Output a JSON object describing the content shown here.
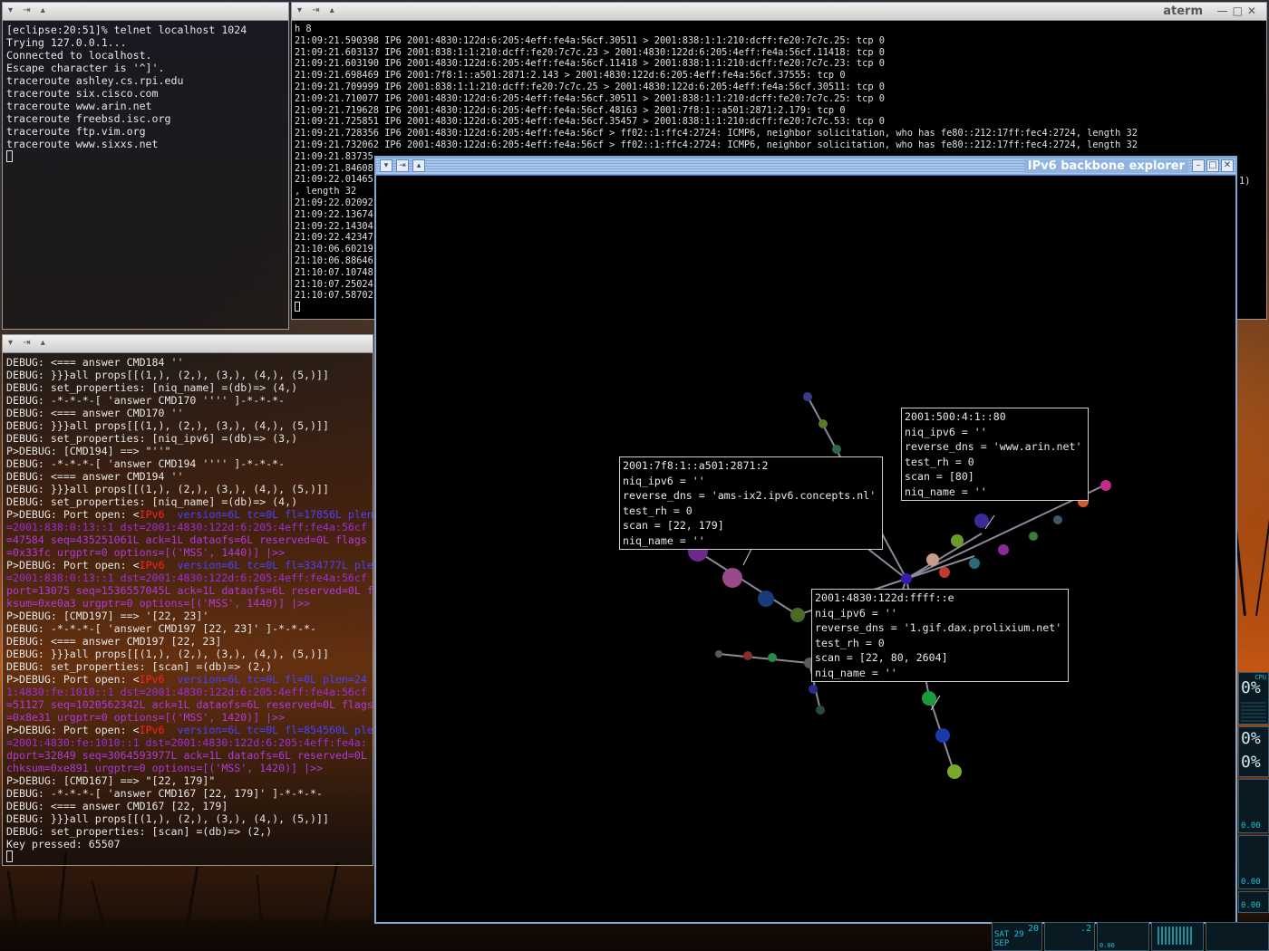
{
  "telnet_window": {
    "lines": [
      "[eclipse:20:51]% telnet localhost 1024",
      "Trying 127.0.0.1...",
      "Connected to localhost.",
      "Escape character is '^]'.",
      "traceroute ashley.cs.rpi.edu",
      "traceroute six.cisco.com",
      "traceroute www.arin.net",
      "traceroute freebsd.isc.org",
      "traceroute ftp.vim.org",
      "traceroute www.sixxs.net"
    ]
  },
  "aterm_window": {
    "title": "aterm",
    "lines": [
      "h 8",
      "21:09:21.590398 IP6 2001:4830:122d:6:205:4eff:fe4a:56cf.30511 > 2001:838:1:1:210:dcff:fe20:7c7c.25: tcp 0",
      "21:09:21.603137 IP6 2001:838:1:1:210:dcff:fe20:7c7c.23 > 2001:4830:122d:6:205:4eff:fe4a:56cf.11418: tcp 0",
      "21:09:21.603190 IP6 2001:4830:122d:6:205:4eff:fe4a:56cf.11418 > 2001:838:1:1:210:dcff:fe20:7c7c.23: tcp 0",
      "21:09:21.698469 IP6 2001:7f8:1::a501:2871:2.143 > 2001:4830:122d:6:205:4eff:fe4a:56cf.37555: tcp 0",
      "21:09:21.709999 IP6 2001:838:1:1:210:dcff:fe20:7c7c.25 > 2001:4830:122d:6:205:4eff:fe4a:56cf.30511: tcp 0",
      "21:09:21.710077 IP6 2001:4830:122d:6:205:4eff:fe4a:56cf.30511 > 2001:838:1:1:210:dcff:fe20:7c7c.25: tcp 0",
      "21:09:21.719628 IP6 2001:4830:122d:6:205:4eff:fe4a:56cf.48163 > 2001:7f8:1::a501:2871:2.179: tcp 0",
      "21:09:21.725851 IP6 2001:4830:122d:6:205:4eff:fe4a:56cf.35457 > 2001:838:1:1:210:dcff:fe20:7c7c.53: tcp 0",
      "21:09:21.728356 IP6 2001:4830:122d:6:205:4eff:fe4a:56cf > ff02::1:ffc4:2724: ICMP6, neighbor solicitation, who has fe80::212:17ff:fec4:2724, length 32",
      "21:09:21.732062 IP6 2001:4830:122d:6:205:4eff:fe4a:56cf > ff02::1:ffc4:2724: ICMP6, neighbor solicitation, who has fe80::212:17ff:fec4:2724, length 32",
      "21:09:21.83735",
      "21:09:21.84608",
      "21:09:22.01465",
      ", length 32",
      "21:09:22.02092",
      "21:09:22.13674",
      "21:09:22.14304",
      "21:09:22.42347",
      "21:10:06.60219",
      "21:10:06.88646",
      "21:10:07.10748",
      "21:10:07.25024",
      "21:10:07.58702"
    ],
    "overflow_text": "1)"
  },
  "debug_window": {
    "lines": [
      [
        {
          "t": "DEBUG: <=== answer CMD184 ''"
        }
      ],
      [
        {
          "t": "DEBUG: }}}all props[[(1,), (2,), (3,), (4,), (5,)]]"
        }
      ],
      [
        {
          "t": "DEBUG: set_properties: [niq_name] =(db)=> (4,)"
        }
      ],
      [
        {
          "t": "DEBUG: -*-*-*-[ 'answer CMD170 '''' ]-*-*-*-"
        }
      ],
      [
        {
          "t": "DEBUG: <=== answer CMD170 ''"
        }
      ],
      [
        {
          "t": "DEBUG: }}}all props[[(1,), (2,), (3,), (4,), (5,)]]"
        }
      ],
      [
        {
          "t": "DEBUG: set_properties: [niq_ipv6] =(db)=> (3,)"
        }
      ],
      [
        {
          "t": "P>DEBUG: [CMD194] ==> \"''\""
        }
      ],
      [
        {
          "t": "DEBUG: -*-*-*-[ 'answer CMD194 '''' ]-*-*-*-"
        }
      ],
      [
        {
          "t": "DEBUG: <=== answer CMD194 ''"
        }
      ],
      [
        {
          "t": "DEBUG: }}}all props[[(1,), (2,), (3,), (4,), (5,)]]"
        }
      ],
      [
        {
          "t": "DEBUG: set_properties: [niq_name] =(db)=> (4,)"
        }
      ],
      [
        {
          "t": "P>DEBUG: Port open: <"
        },
        {
          "t": "IPv6",
          "c": "c-red"
        },
        {
          "t": "  version=6L tc=0L fl=17856L plen",
          "c": "c-blue"
        }
      ],
      [
        {
          "t": "=2001:838:0:13::1 dst=2001:4830:122d:6:205:4eff:fe4a:56cf",
          "c": "c-purple"
        }
      ],
      [
        {
          "t": "=47584 seq=435251061L ack=1L dataofs=6L reserved=0L flags",
          "c": "c-violet"
        }
      ],
      [
        {
          "t": "=0x33fc urgptr=0 options=[('MSS', 1440)] |>>",
          "c": "c-violet"
        }
      ],
      [
        {
          "t": "P>DEBUG: Port open: <"
        },
        {
          "t": "IPv6",
          "c": "c-red"
        },
        {
          "t": "  version=6L tc=0L fl=334777L ple",
          "c": "c-blue"
        }
      ],
      [
        {
          "t": "=2001:838:0:13::1 dst=2001:4830:122d:6:205:4eff:fe4a:56cf",
          "c": "c-purple"
        }
      ],
      [
        {
          "t": "port=13075 seq=1536557045L ack=1L dataofs=6L reserved=0L f",
          "c": "c-violet"
        }
      ],
      [
        {
          "t": "ksum=0xe0a3 urgptr=0 options=[('MSS', 1440)] |>>",
          "c": "c-violet"
        }
      ],
      [
        {
          "t": "P>DEBUG: [CMD197] ==> '[22, 23]'"
        }
      ],
      [
        {
          "t": "DEBUG: -*-*-*-[ 'answer CMD197 [22, 23]' ]-*-*-*-"
        }
      ],
      [
        {
          "t": "DEBUG: <=== answer CMD197 [22, 23]"
        }
      ],
      [
        {
          "t": "DEBUG: }}}all props[[(1,), (2,), (3,), (4,), (5,)]]"
        }
      ],
      [
        {
          "t": "DEBUG: set_properties: [scan] =(db)=> (2,)"
        }
      ],
      [
        {
          "t": "P>DEBUG: Port open: <"
        },
        {
          "t": "IPv6",
          "c": "c-red"
        },
        {
          "t": "  version=6L tc=0L fl=0L plen=24",
          "c": "c-blue"
        }
      ],
      [
        {
          "t": "1:4830:fe:1010::1 dst=2001:4830:122d:6:205:4eff:fe4a:56cf",
          "c": "c-purple"
        }
      ],
      [
        {
          "t": "=51127 seq=1020562342L ack=1L dataofs=6L reserved=0L flags",
          "c": "c-violet"
        }
      ],
      [
        {
          "t": "=0x8e31 urgptr=0 options=[('MSS', 1420)] |>>",
          "c": "c-violet"
        }
      ],
      [
        {
          "t": "P>DEBUG: Port open: <"
        },
        {
          "t": "IPv6",
          "c": "c-red"
        },
        {
          "t": "  version=6L tc=0L fl=854560L ple",
          "c": "c-blue"
        }
      ],
      [
        {
          "t": "=2001:4830:fe:1010::1 dst=2001:4830:122d:6:205:4eff:fe4a:",
          "c": "c-purple"
        }
      ],
      [
        {
          "t": "dport=32849 seq=3064593977L ack=1L dataofs=6L reserved=0L",
          "c": "c-violet"
        }
      ],
      [
        {
          "t": "chksum=0xe891 urgptr=0 options=[('MSS', 1420)] |>>",
          "c": "c-violet"
        }
      ],
      [
        {
          "t": "P>DEBUG: [CMD167] ==> \"[22, 179]\""
        }
      ],
      [
        {
          "t": "DEBUG: -*-*-*-[ 'answer CMD167 [22, 179]' ]-*-*-*-"
        }
      ],
      [
        {
          "t": "DEBUG: <=== answer CMD167 [22, 179]"
        }
      ],
      [
        {
          "t": "DEBUG: }}}all props[[(1,), (2,), (3,), (4,), (5,)]]"
        }
      ],
      [
        {
          "t": "DEBUG: set_properties: [scan] =(db)=> (2,)"
        }
      ],
      [
        {
          "t": "Key pressed: 65507"
        }
      ]
    ]
  },
  "explorer_window": {
    "title": "IPv6 backbone explorer",
    "nodes_info": [
      {
        "lines": [
          "2001:7f8:1::a501:2871:2",
          "niq_ipv6 = ''",
          "reverse_dns = 'ams-ix2.ipv6.concepts.nl'",
          "test_rh = 0",
          "scan = [22, 179]",
          "niq_name = ''"
        ]
      },
      {
        "lines": [
          "2001:500:4:1::80",
          "niq_ipv6 = ''",
          "reverse_dns = 'www.arin.net'",
          "test_rh = 0",
          "scan = [80]",
          "niq_name = ''"
        ]
      },
      {
        "lines": [
          "2001:4830:122d:ffff::e",
          "niq_ipv6 = ''",
          "reverse_dns = '1.gif.dax.prolixium.net'",
          "test_rh = 0",
          "scan = [22, 80, 2604]",
          "niq_name = ''"
        ]
      }
    ],
    "colors": {
      "frame": "#7fa7d8",
      "canvas": "#000000"
    }
  },
  "dock": {
    "cpu_label": "CPU",
    "cpu_value": "0%",
    "mem_value": "0%",
    "swap_value": "0%",
    "net_values": [
      "0.00",
      "0.00",
      "0.00",
      "0.00"
    ],
    "clock_time": "20",
    "clock_date": "SAT 29 SEP",
    "load_value": ".2"
  }
}
